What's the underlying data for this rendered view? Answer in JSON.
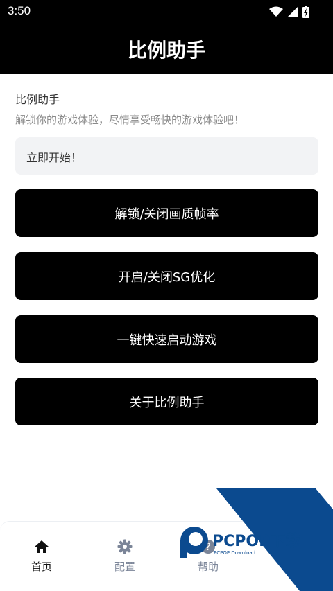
{
  "status_bar": {
    "time": "3:50"
  },
  "app_bar": {
    "title": "比例助手"
  },
  "intro": {
    "title": "比例助手",
    "subtitle": "解锁你的游戏体验，尽情享受畅快的游戏体验吧！"
  },
  "start_box": {
    "text": "立即开始！"
  },
  "buttons": [
    {
      "label": "解锁/关闭画质帧率"
    },
    {
      "label": "开启/关闭SG优化"
    },
    {
      "label": "一键快速启动游戏"
    },
    {
      "label": "关于比例助手"
    }
  ],
  "bottom_nav": {
    "items": [
      {
        "label": "首页",
        "icon": "home-icon",
        "active": true
      },
      {
        "label": "配置",
        "icon": "gear-icon",
        "active": false
      },
      {
        "label": "帮助",
        "icon": "help-icon",
        "active": false
      }
    ]
  },
  "watermark": {
    "brand": "PCPOP下载",
    "sub": "PCPOP Download"
  },
  "colors": {
    "header_bg": "#000000",
    "button_bg": "#000000",
    "inactive_nav": "#7b8598",
    "watermark_blue": "#0b4a8f"
  }
}
